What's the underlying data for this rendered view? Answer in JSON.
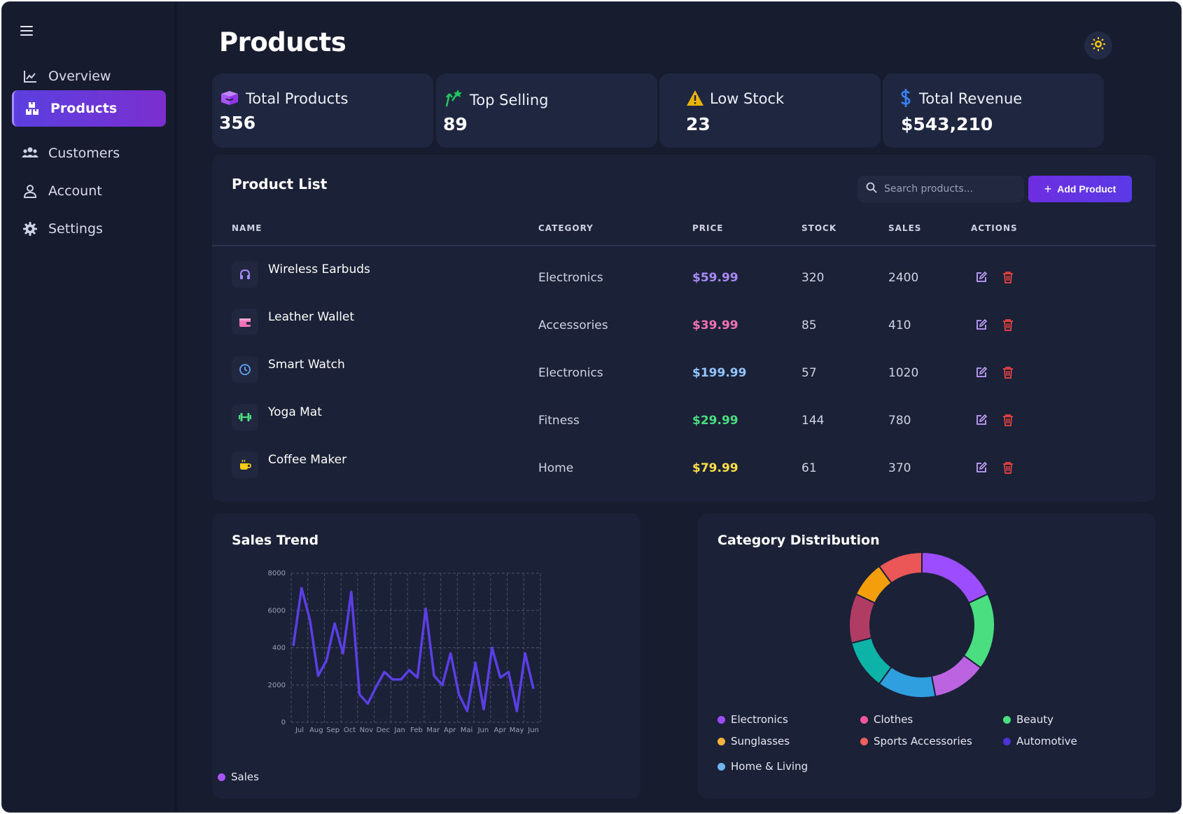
{
  "sidebar": {
    "items": [
      {
        "label": "Overview",
        "icon": "line-chart-icon",
        "active": false
      },
      {
        "label": "Products",
        "icon": "boxes-icon",
        "active": true
      },
      {
        "label": "Customers",
        "icon": "users-icon",
        "active": false
      },
      {
        "label": "Account",
        "icon": "user-icon",
        "active": false
      },
      {
        "label": "Settings",
        "icon": "gear-icon",
        "active": false
      }
    ]
  },
  "header": {
    "title": "Products",
    "theme_icon": "sun-icon"
  },
  "stats": [
    {
      "label": "Total Products",
      "value": "356",
      "icon": "box-icon",
      "color": "#a855f7"
    },
    {
      "label": "Top Selling",
      "value": "89",
      "icon": "trending-up-icon",
      "color": "#22c55e"
    },
    {
      "label": "Low Stock",
      "value": "23",
      "icon": "warning-icon",
      "color": "#eab308"
    },
    {
      "label": "Total Revenue",
      "value": "$543,210",
      "icon": "dollar-icon",
      "color": "#3b82f6"
    }
  ],
  "product_list": {
    "title": "Product List",
    "search_placeholder": "Search products...",
    "add_label": "Add Product",
    "columns": [
      "NAME",
      "CATEGORY",
      "PRICE",
      "STOCK",
      "SALES",
      "ACTIONS"
    ],
    "rows": [
      {
        "name": "Wireless Earbuds",
        "category": "Electronics",
        "price": "$59.99",
        "stock": "320",
        "sales": "2400",
        "icon": "headphones-icon",
        "color": "#a78bfa"
      },
      {
        "name": "Leather Wallet",
        "category": "Accessories",
        "price": "$39.99",
        "stock": "85",
        "sales": "410",
        "icon": "wallet-icon",
        "color": "#f472b6"
      },
      {
        "name": "Smart Watch",
        "category": "Electronics",
        "price": "$199.99",
        "stock": "57",
        "sales": "1020",
        "icon": "clock-icon",
        "color": "#93c5fd"
      },
      {
        "name": "Yoga Mat",
        "category": "Fitness",
        "price": "$29.99",
        "stock": "144",
        "sales": "780",
        "icon": "dumbbell-icon",
        "color": "#4ade80"
      },
      {
        "name": "Coffee Maker",
        "category": "Home",
        "price": "$79.99",
        "stock": "61",
        "sales": "370",
        "icon": "coffee-icon",
        "color": "#fde047"
      }
    ]
  },
  "sales_trend": {
    "title": "Sales Trend",
    "legend": "Sales"
  },
  "category_distribution": {
    "title": "Category Distribution"
  },
  "chart_data": [
    {
      "type": "line",
      "title": "Sales Trend",
      "ytick_labels": [
        "0",
        "2000",
        "400",
        "6000",
        "8000"
      ],
      "ylim": [
        0,
        8000
      ],
      "x_tick_labels": [
        "Jul",
        "Aug",
        "Sep",
        "Oct",
        "Nov",
        "Dec",
        "Jan",
        "Feb",
        "Mar",
        "Apr",
        "Mai",
        "Jun",
        "Apr",
        "May",
        "Jun"
      ],
      "grid": true,
      "legend_position": "bottom-left",
      "series": [
        {
          "name": "Sales",
          "color": "#5b3fe6",
          "values": [
            4100,
            7200,
            5500,
            2500,
            3300,
            5300,
            3700,
            7000,
            1500,
            1000,
            1900,
            2700,
            2300,
            2300,
            2800,
            2400,
            6100,
            2500,
            2000,
            3700,
            1500,
            600,
            3200,
            700,
            4000,
            2400,
            2700,
            600,
            3700,
            1800
          ]
        }
      ]
    },
    {
      "type": "pie",
      "title": "Category Distribution",
      "donut": true,
      "legend_position": "bottom",
      "categories": [
        "Electronics",
        "Clothes",
        "Beauty",
        "Sunglasses",
        "Sports Accessories",
        "Automotive",
        "Home & Living"
      ],
      "legend_colors": [
        "#9b4dff",
        "#f0569a",
        "#4ade80",
        "#f6b23a",
        "#f25f5f",
        "#4c33d6",
        "#6fb3f0"
      ],
      "slices": [
        {
          "value": 18,
          "color": "#9b4dff"
        },
        {
          "value": 17,
          "color": "#4ade80"
        },
        {
          "value": 12,
          "color": "#bb63e0"
        },
        {
          "value": 13,
          "color": "#2f9fe0"
        },
        {
          "value": 11,
          "color": "#0db3a6"
        },
        {
          "value": 11,
          "color": "#b03c63"
        },
        {
          "value": 8,
          "color": "#f59e0b"
        },
        {
          "value": 10,
          "color": "#eb5656"
        }
      ]
    }
  ]
}
